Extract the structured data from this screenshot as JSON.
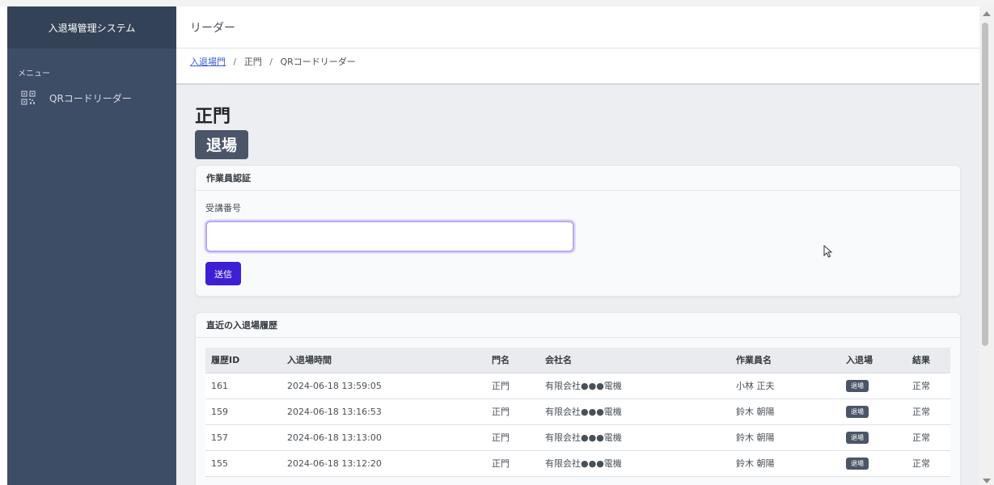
{
  "app": {
    "brand": "入退場管理システム",
    "page_title": "リーダー"
  },
  "sidebar": {
    "heading": "メニュー",
    "items": [
      {
        "label": "QRコードリーダー",
        "icon": "qr-code-icon"
      }
    ]
  },
  "breadcrumb": {
    "items": [
      "入退場門",
      "正門",
      "QRコードリーダー"
    ],
    "separator": "/"
  },
  "gate": {
    "name": "正門",
    "mode": "退場"
  },
  "auth_card": {
    "title": "作業員認証",
    "field_label": "受講番号",
    "field_value": "",
    "submit_label": "送信"
  },
  "history_card": {
    "title": "直近の入退場履歴",
    "columns": [
      "履歴ID",
      "入退場時間",
      "門名",
      "会社名",
      "作業員名",
      "入退場",
      "結果"
    ],
    "rows": [
      [
        "161",
        "2024-06-18 13:59:05",
        "正門",
        "有限会社●●●電機",
        "小林 正夫",
        "退場",
        "正常"
      ],
      [
        "159",
        "2024-06-18 13:16:53",
        "正門",
        "有限会社●●●電機",
        "鈴木 朝陽",
        "退場",
        "正常"
      ],
      [
        "157",
        "2024-06-18 13:13:00",
        "正門",
        "有限会社●●●電機",
        "鈴木 朝陽",
        "退場",
        "正常"
      ],
      [
        "155",
        "2024-06-18 13:12:20",
        "正門",
        "有限会社●●●電機",
        "鈴木 朝陽",
        "退場",
        "正常"
      ]
    ]
  },
  "colors": {
    "sidebar_bg": "#3e4d66",
    "brand_bg": "#344257",
    "primary_button": "#3d1fd6",
    "badge": "#4a5668"
  }
}
